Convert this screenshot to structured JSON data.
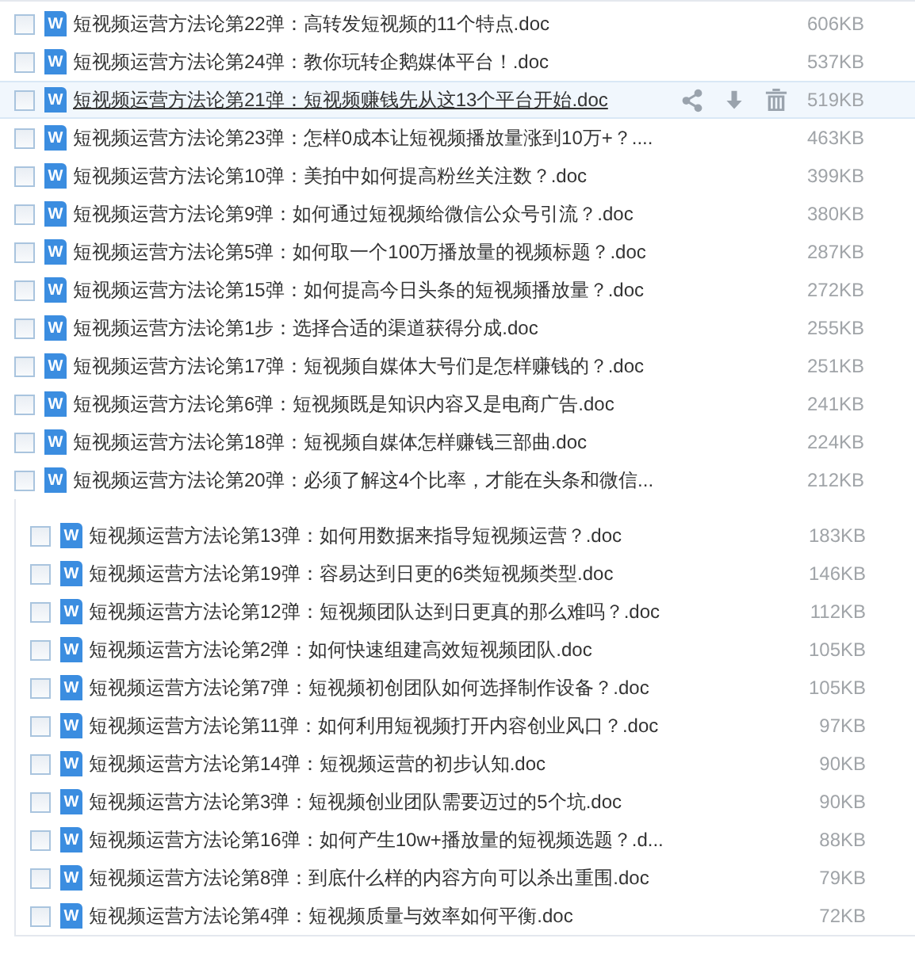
{
  "top_list": {
    "rows": [
      {
        "icon_letter": "W",
        "name": "短视频运营方法论第22弹：高转发短视频的11个特点.doc",
        "size": "606KB",
        "checked": false,
        "hovered": false
      },
      {
        "icon_letter": "W",
        "name": "短视频运营方法论第24弹：教你玩转企鹅媒体平台！.doc",
        "size": "537KB",
        "checked": false,
        "hovered": false
      },
      {
        "icon_letter": "W",
        "name": "短视频运营方法论第21弹：短视频赚钱先从这13个平台开始.doc",
        "size": "519KB",
        "checked": false,
        "hovered": true
      },
      {
        "icon_letter": "W",
        "name": "短视频运营方法论第23弹：怎样0成本让短视频播放量涨到10万+？....",
        "size": "463KB",
        "checked": false,
        "hovered": false
      },
      {
        "icon_letter": "W",
        "name": "短视频运营方法论第10弹：美拍中如何提高粉丝关注数？.doc",
        "size": "399KB",
        "checked": false,
        "hovered": false
      },
      {
        "icon_letter": "W",
        "name": "短视频运营方法论第9弹：如何通过短视频给微信公众号引流？.doc",
        "size": "380KB",
        "checked": false,
        "hovered": false
      },
      {
        "icon_letter": "W",
        "name": "短视频运营方法论第5弹：如何取一个100万播放量的视频标题？.doc",
        "size": "287KB",
        "checked": false,
        "hovered": false
      },
      {
        "icon_letter": "W",
        "name": "短视频运营方法论第15弹：如何提高今日头条的短视频播放量？.doc",
        "size": "272KB",
        "checked": false,
        "hovered": false
      },
      {
        "icon_letter": "W",
        "name": "短视频运营方法论第1步：选择合适的渠道获得分成.doc",
        "size": "255KB",
        "checked": false,
        "hovered": false
      },
      {
        "icon_letter": "W",
        "name": "短视频运营方法论第17弹：短视频自媒体大号们是怎样赚钱的？.doc",
        "size": "251KB",
        "checked": false,
        "hovered": false
      },
      {
        "icon_letter": "W",
        "name": "短视频运营方法论第6弹：短视频既是知识内容又是电商广告.doc",
        "size": "241KB",
        "checked": false,
        "hovered": false
      },
      {
        "icon_letter": "W",
        "name": "短视频运营方法论第18弹：短视频自媒体怎样赚钱三部曲.doc",
        "size": "224KB",
        "checked": false,
        "hovered": false
      },
      {
        "icon_letter": "W",
        "name": "短视频运营方法论第20弹：必须了解这4个比率，才能在头条和微信...",
        "size": "212KB",
        "checked": false,
        "hovered": false
      }
    ]
  },
  "bottom_list": {
    "rows": [
      {
        "icon_letter": "W",
        "name": "短视频运营方法论第13弹：如何用数据来指导短视频运营？.doc",
        "size": "183KB",
        "checked": false
      },
      {
        "icon_letter": "W",
        "name": "短视频运营方法论第19弹：容易达到日更的6类短视频类型.doc",
        "size": "146KB",
        "checked": false
      },
      {
        "icon_letter": "W",
        "name": "短视频运营方法论第12弹：短视频团队达到日更真的那么难吗？.doc",
        "size": "112KB",
        "checked": false
      },
      {
        "icon_letter": "W",
        "name": "短视频运营方法论第2弹：如何快速组建高效短视频团队.doc",
        "size": "105KB",
        "checked": false
      },
      {
        "icon_letter": "W",
        "name": "短视频运营方法论第7弹：短视频初创团队如何选择制作设备？.doc",
        "size": "105KB",
        "checked": false
      },
      {
        "icon_letter": "W",
        "name": "短视频运营方法论第11弹：如何利用短视频打开内容创业风口？.doc",
        "size": "97KB",
        "checked": false
      },
      {
        "icon_letter": "W",
        "name": "短视频运营方法论第14弹：短视频运营的初步认知.doc",
        "size": "90KB",
        "checked": false
      },
      {
        "icon_letter": "W",
        "name": "短视频运营方法论第3弹：短视频创业团队需要迈过的5个坑.doc",
        "size": "90KB",
        "checked": false
      },
      {
        "icon_letter": "W",
        "name": "短视频运营方法论第16弹：如何产生10w+播放量的短视频选题？.d...",
        "size": "88KB",
        "checked": false
      },
      {
        "icon_letter": "W",
        "name": "短视频运营方法论第8弹：到底什么样的内容方向可以杀出重围.doc",
        "size": "79KB",
        "checked": false
      },
      {
        "icon_letter": "W",
        "name": "短视频运营方法论第4弹：短视频质量与效率如何平衡.doc",
        "size": "72KB",
        "checked": false
      }
    ]
  }
}
